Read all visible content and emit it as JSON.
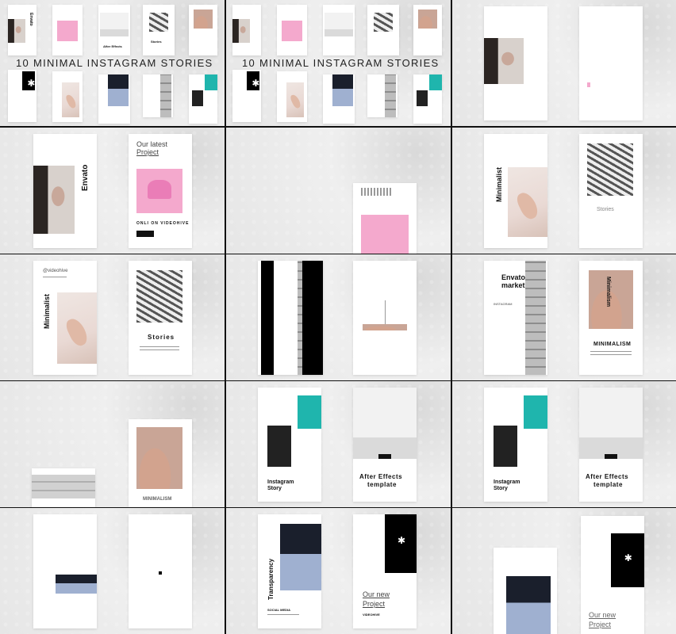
{
  "header": {
    "title_line": "10 MINIMAL INSTAGRAM STORIES"
  },
  "texts": {
    "envato": "Envato",
    "our_latest": "Our latest",
    "project": "Project",
    "only_on": "ONLI ON VIDEOHIVE",
    "minimalist": "Minimalist",
    "stories": "Stories",
    "videohive_tag": "@videohive",
    "envato_market_1": "Envato",
    "envato_market_2": "market",
    "instagram_small": "INSTAGRAM",
    "minimalism": "MINIMALISM",
    "minimalism_vert": "Minimalism",
    "after_effects_1": "After Effects",
    "after_effects_2": "template",
    "instagram_story_1": "Instagram",
    "instagram_story_2": "Story",
    "transparency": "Transparency",
    "social_media": "SOCIAL MEDIA",
    "our_new": "Our new",
    "project2": "Project",
    "videohive_small": "VIDEOHIVE"
  },
  "colors": {
    "accent_pink": "#f4a9cd",
    "accent_teal": "#1fb5ad"
  }
}
